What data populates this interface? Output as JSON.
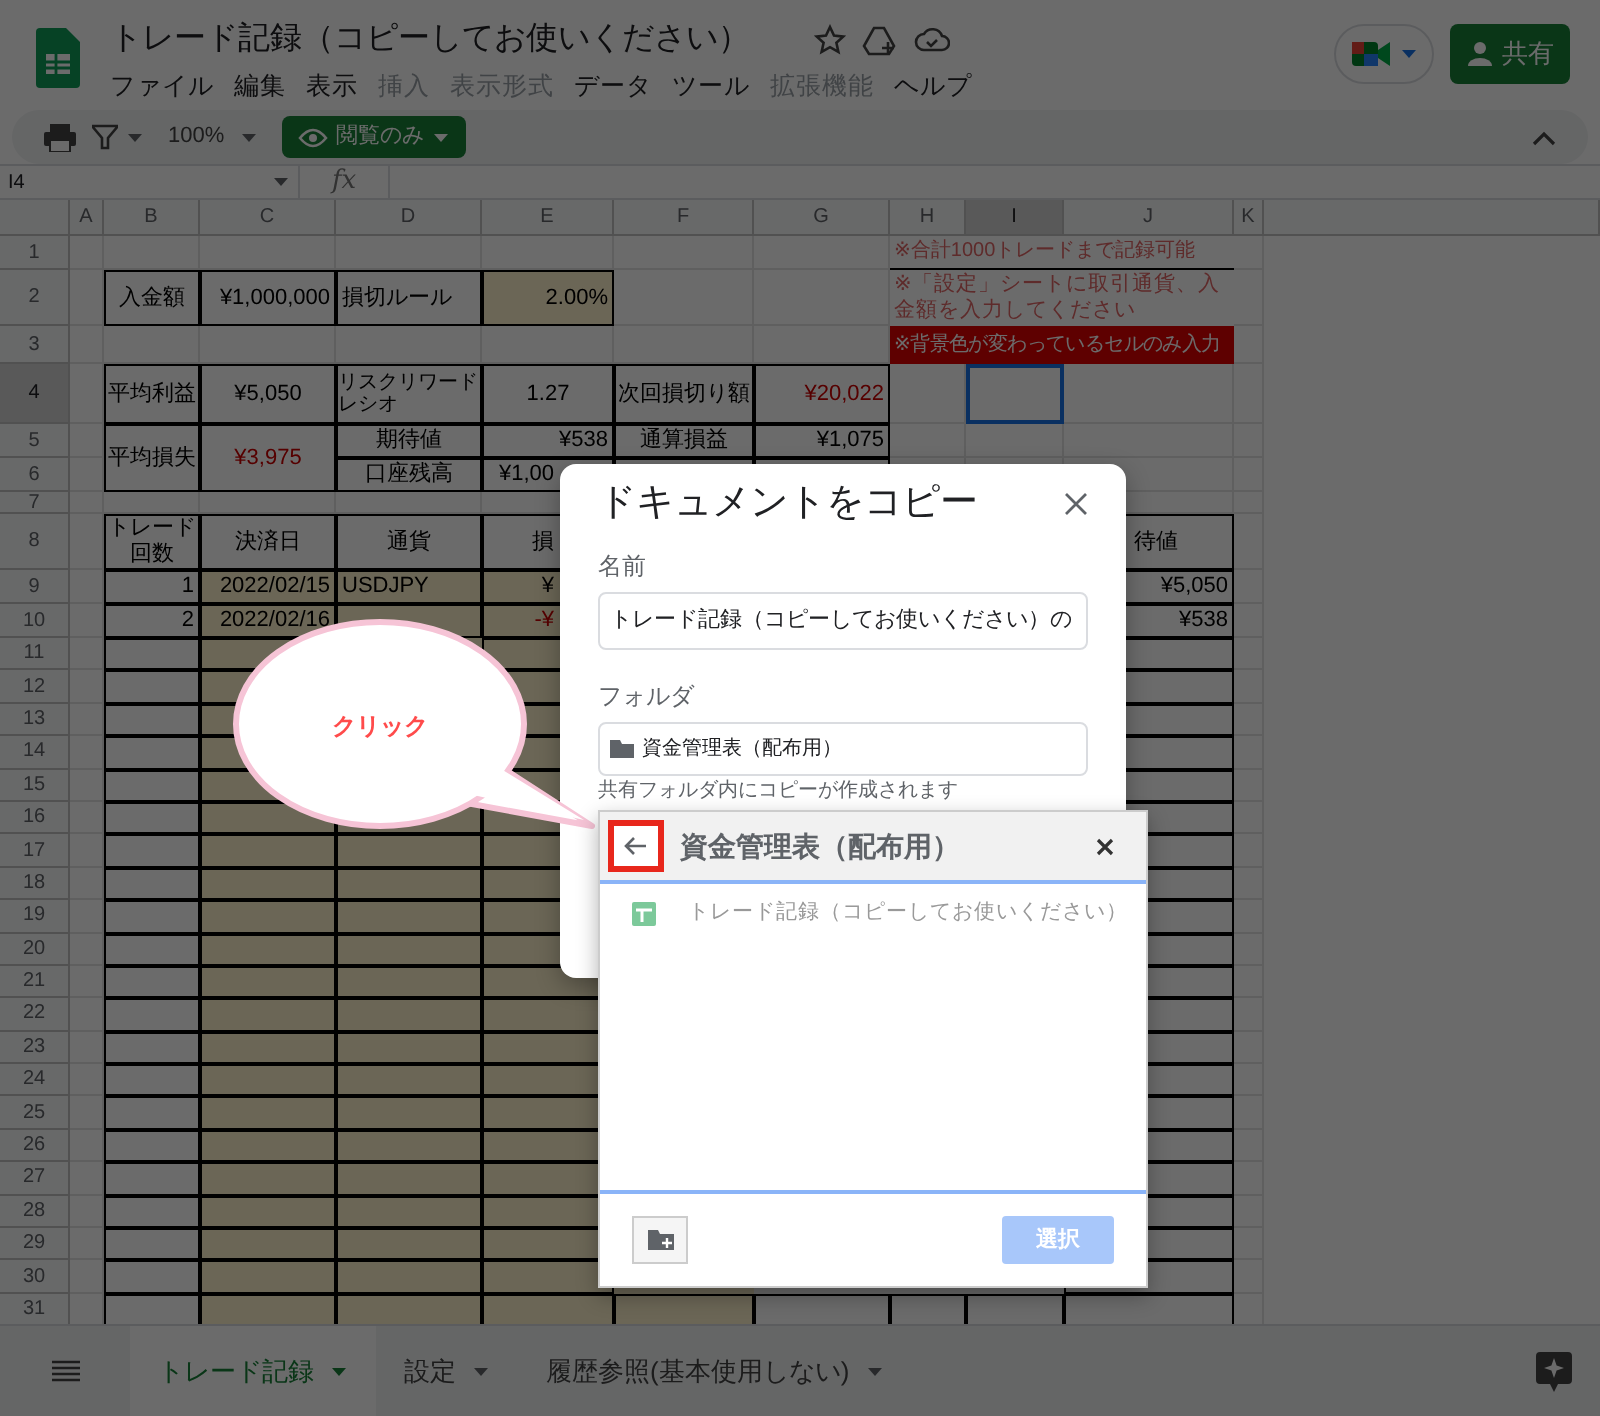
{
  "app": {
    "title": "トレード記録（コピーしてお使いください）",
    "share_button": "共有",
    "menu": [
      {
        "label": "ファイル",
        "disabled": false
      },
      {
        "label": "編集",
        "disabled": false
      },
      {
        "label": "表示",
        "disabled": false
      },
      {
        "label": "挿入",
        "disabled": true
      },
      {
        "label": "表示形式",
        "disabled": true
      },
      {
        "label": "データ",
        "disabled": false
      },
      {
        "label": "ツール",
        "disabled": false
      },
      {
        "label": "拡張機能",
        "disabled": true
      },
      {
        "label": "ヘルプ",
        "disabled": false
      }
    ]
  },
  "toolbar": {
    "zoom": "100%",
    "mode_button": "閲覧のみ"
  },
  "formula_bar": {
    "name_box": "I4",
    "function_label": "fx"
  },
  "sheet": {
    "columns": [
      "A",
      "B",
      "C",
      "D",
      "E",
      "F",
      "G",
      "H",
      "I",
      "J",
      "K"
    ],
    "rows": [
      {
        "number": "1"
      },
      {
        "number": "2",
        "cells": {
          "B": {
            "text": "入金額",
            "kind": "label",
            "negative": false
          },
          "C": {
            "text": "¥1,000,000",
            "kind": "number",
            "negative": false
          },
          "D": {
            "text": "損切ルール",
            "kind": "text",
            "negative": false
          },
          "E": {
            "text": "2.00%",
            "kind": "number",
            "negative": false
          }
        }
      },
      {
        "number": "3"
      },
      {
        "number": "4",
        "cells": {
          "B": {
            "text": "平均利益",
            "kind": "label",
            "negative": false
          },
          "C": {
            "text": "¥5,050",
            "kind": "label",
            "negative": false
          },
          "D": {
            "text": "リスクリワードレシオ",
            "kind": "small",
            "negative": false
          },
          "E": {
            "text": "1.27",
            "kind": "label",
            "negative": false
          },
          "F": {
            "text": "次回損切り額",
            "kind": "label",
            "negative": false
          },
          "G": {
            "text": "¥20,022",
            "kind": "number",
            "negative": true
          }
        }
      },
      {
        "number": "5",
        "cells": {
          "B": {
            "text": "平均損失",
            "kind": "label",
            "negative": false
          },
          "C": {
            "text": "¥3,975",
            "kind": "label",
            "negative": true
          },
          "D": {
            "text": "期待値",
            "kind": "label",
            "negative": false
          },
          "E": {
            "text": "¥538",
            "kind": "number",
            "negative": false
          },
          "F": {
            "text": "通算損益",
            "kind": "label",
            "negative": false
          },
          "G": {
            "text": "¥1,075",
            "kind": "number",
            "negative": false
          }
        }
      },
      {
        "number": "6",
        "cells": {
          "D": {
            "text": "口座残高",
            "kind": "label",
            "negative": false
          },
          "E": {
            "text": "¥1,00",
            "kind": "number",
            "negative": false,
            "clipped_right": true
          }
        }
      },
      {
        "number": "7"
      },
      {
        "number": "8",
        "cells": {
          "B": {
            "text": "トレード回数",
            "kind": "label",
            "negative": false
          },
          "C": {
            "text": "決済日",
            "kind": "label",
            "negative": false
          },
          "D": {
            "text": "通貨",
            "kind": "label",
            "negative": false
          },
          "E": {
            "text": "損",
            "kind": "label",
            "negative": false,
            "clipped_right": true
          },
          "J": {
            "text": "待値",
            "kind": "label",
            "negative": false,
            "clipped_left": true
          }
        }
      },
      {
        "number": "9",
        "cells": {
          "B": {
            "text": "1",
            "kind": "number",
            "negative": false
          },
          "C": {
            "text": "2022/02/15",
            "kind": "number",
            "negative": false
          },
          "D": {
            "text": "USDJPY",
            "kind": "text",
            "negative": false
          },
          "E": {
            "text": "¥",
            "kind": "number",
            "negative": false,
            "clipped_right": true
          },
          "J": {
            "text": "¥5,050",
            "kind": "number",
            "negative": false
          }
        }
      },
      {
        "number": "10",
        "cells": {
          "B": {
            "text": "2",
            "kind": "number",
            "negative": false
          },
          "C": {
            "text": "2022/02/16",
            "kind": "number",
            "negative": false
          },
          "E": {
            "text": "-¥",
            "kind": "number",
            "negative": true,
            "clipped_right": true
          },
          "J": {
            "text": "¥538",
            "kind": "number",
            "negative": false
          }
        }
      },
      {
        "number": "11"
      },
      {
        "number": "12"
      },
      {
        "number": "13"
      },
      {
        "number": "14"
      },
      {
        "number": "15"
      },
      {
        "number": "16"
      },
      {
        "number": "17"
      },
      {
        "number": "18"
      },
      {
        "number": "19"
      },
      {
        "number": "20"
      },
      {
        "number": "21"
      },
      {
        "number": "22"
      },
      {
        "number": "23"
      },
      {
        "number": "24"
      },
      {
        "number": "25"
      },
      {
        "number": "26"
      },
      {
        "number": "27"
      },
      {
        "number": "28"
      },
      {
        "number": "29"
      },
      {
        "number": "30"
      },
      {
        "number": "31"
      }
    ],
    "notes": [
      {
        "text": "※合計1000トレードまで記録可能",
        "kind": "note"
      },
      {
        "text": "※「設定」シートに取引通貨、入金額を入力してください",
        "kind": "note"
      },
      {
        "text": "※背景色が変わっているセルのみ入力",
        "kind": "warning"
      }
    ]
  },
  "sheet_tabs": [
    {
      "label": "トレード記録",
      "selected": true
    },
    {
      "label": "設定",
      "selected": false
    },
    {
      "label": "履歴参照(基本使用しない)",
      "selected": false
    }
  ],
  "copy_dialog": {
    "title": "ドキュメントをコピー",
    "name_label": "名前",
    "name_value": "トレード記録（コピーしてお使いください）の",
    "folder_label": "フォルダ",
    "folder_value": "資金管理表（配布用）",
    "note": "共有フォルダ内にコピーが作成されます"
  },
  "folder_picker": {
    "title": "資金管理表（配布用）",
    "select_button": "選択",
    "select_disabled": true,
    "items": [
      {
        "name": "トレード記録（コピーしてお使いください）",
        "kind": "spreadsheet"
      }
    ]
  },
  "callout": {
    "text": "クリック"
  }
}
